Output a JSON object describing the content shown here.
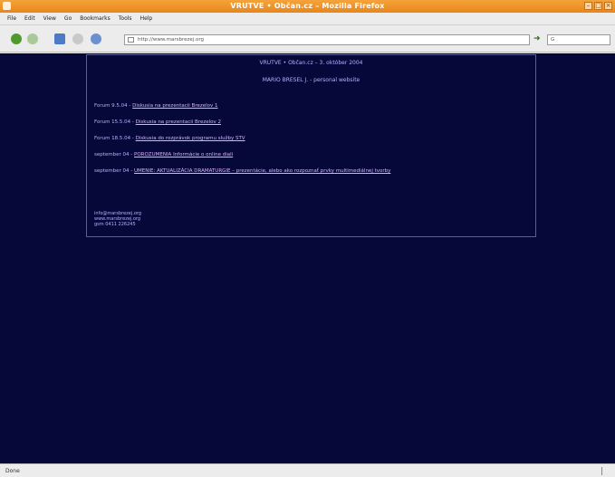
{
  "window": {
    "title": "VRUTVE • Občan.cz – Mozilla Firefox"
  },
  "menubar": {
    "items": [
      "File",
      "Edit",
      "View",
      "Go",
      "Bookmarks",
      "Tools",
      "Help"
    ]
  },
  "navbar": {
    "url": "http://www.marsbrezej.org",
    "search_placeholder": "G"
  },
  "page": {
    "header_line_1": "VRUTVE • Občan.cz – 3. október 2004",
    "header_line_2": "MARIO BRESEL J. - personal website",
    "entries": [
      {
        "date": "Forum 9.5.04",
        "link": "Diskusia na prezentacii Brezelov 1"
      },
      {
        "date": "Forum 15.5.04",
        "link": "Diskusia na prezentacii Brezelov 2"
      },
      {
        "date": "Forum 18.5.04",
        "link": "Diskusia do rozprávok programu služby STV"
      },
      {
        "date": "september 04",
        "link": "POROZUMENIA Informácie o online diali"
      },
      {
        "date": "september 04",
        "link": "UMENIE: AKTUALIZÁCIA DRAMATURGIE – prezentácie, alebo ako rozpoznať prvky multimediálnej tvorby"
      }
    ],
    "contact": {
      "email": "info@marsbrezej.org",
      "web": "www.marsbrezej.org",
      "phone": "gsm 0411 226245"
    }
  },
  "statusbar": {
    "text": "Done"
  }
}
